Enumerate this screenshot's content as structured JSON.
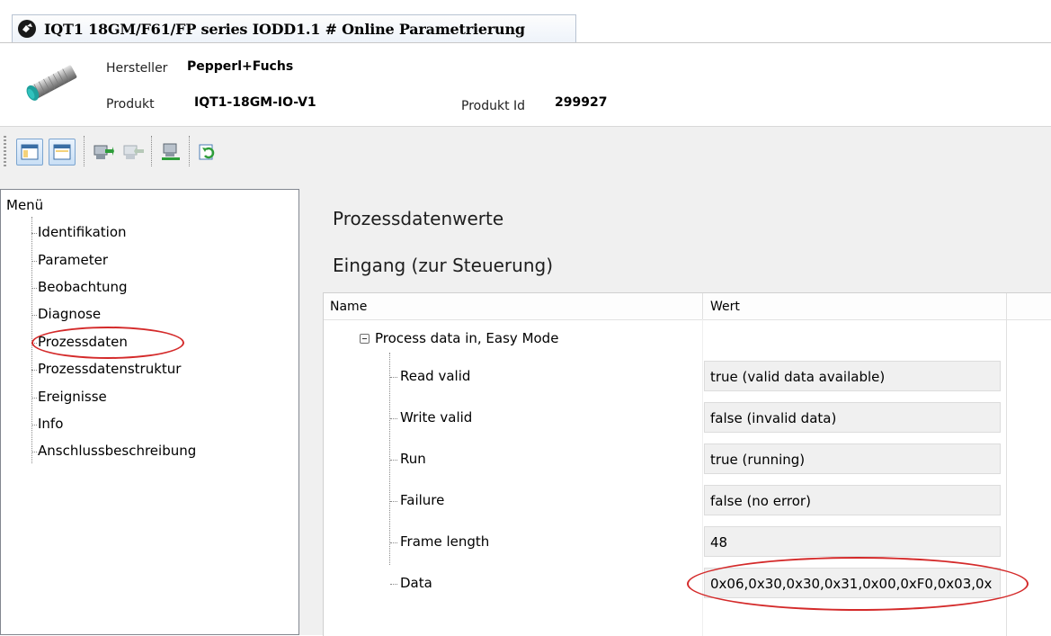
{
  "window": {
    "tab_title": "IQT1 18GM/F61/FP series IODD1.1 # Online Parametrierung"
  },
  "header": {
    "manufacturer_label": "Hersteller",
    "manufacturer_value": "Pepperl+Fuchs",
    "product_label": "Produkt",
    "product_value": "IQT1-18GM-IO-V1",
    "product_id_label": "Produkt Id",
    "product_id_value": "299927"
  },
  "toolbar": {
    "icons": [
      "layout-view-icon",
      "layout-view-2-icon",
      "upload-to-device-icon",
      "download-from-device-icon",
      "network-device-icon",
      "refresh-export-icon"
    ]
  },
  "menu": {
    "title": "Menü",
    "items": [
      {
        "label": "Identifikation"
      },
      {
        "label": "Parameter"
      },
      {
        "label": "Beobachtung"
      },
      {
        "label": "Diagnose"
      },
      {
        "label": "Prozessdaten",
        "highlighted": true
      },
      {
        "label": "Prozessdatenstruktur"
      },
      {
        "label": "Ereignisse"
      },
      {
        "label": "Info"
      },
      {
        "label": "Anschlussbeschreibung"
      }
    ]
  },
  "content": {
    "title": "Prozessdatenwerte",
    "subtitle": "Eingang (zur Steuerung)",
    "grid": {
      "col_name": "Name",
      "col_value": "Wert",
      "group_label": "Process data in, Easy Mode",
      "rows": [
        {
          "name": "Read valid",
          "value": "true (valid data available)"
        },
        {
          "name": "Write valid",
          "value": "false (invalid data)"
        },
        {
          "name": "Run",
          "value": "true (running)"
        },
        {
          "name": "Failure",
          "value": "false (no error)"
        },
        {
          "name": "Frame length",
          "value": "48"
        },
        {
          "name": "Data",
          "value": "0x06,0x30,0x30,0x31,0x00,0xF0,0x03,0x"
        }
      ]
    }
  },
  "colors": {
    "highlight_ellipse": "#d42a2a",
    "toolbar_bg": "#f0f0f0"
  }
}
